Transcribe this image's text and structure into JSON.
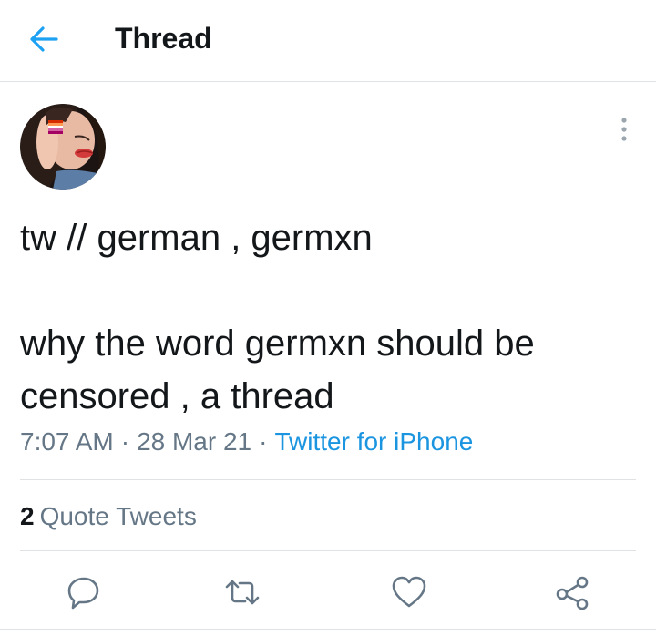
{
  "header": {
    "title": "Thread",
    "back_icon": "arrow-left-icon"
  },
  "tweet": {
    "text": "tw // german , germxn\n\nwhy the word germxn should be censored , a thread",
    "time": "7:07 AM",
    "date": "28 Mar 21",
    "separator": "·",
    "client": "Twitter for iPhone"
  },
  "stats": {
    "quote_count": "2",
    "quote_label": "Quote Tweets"
  },
  "actions": {
    "reply_icon": "reply-icon",
    "retweet_icon": "retweet-icon",
    "like_icon": "heart-icon",
    "share_icon": "share-icon"
  },
  "colors": {
    "accent": "#1da1f2",
    "link": "#1b95e0",
    "secondary_text": "#657786",
    "primary_text": "#14171a",
    "divider": "#dfe3e6"
  }
}
